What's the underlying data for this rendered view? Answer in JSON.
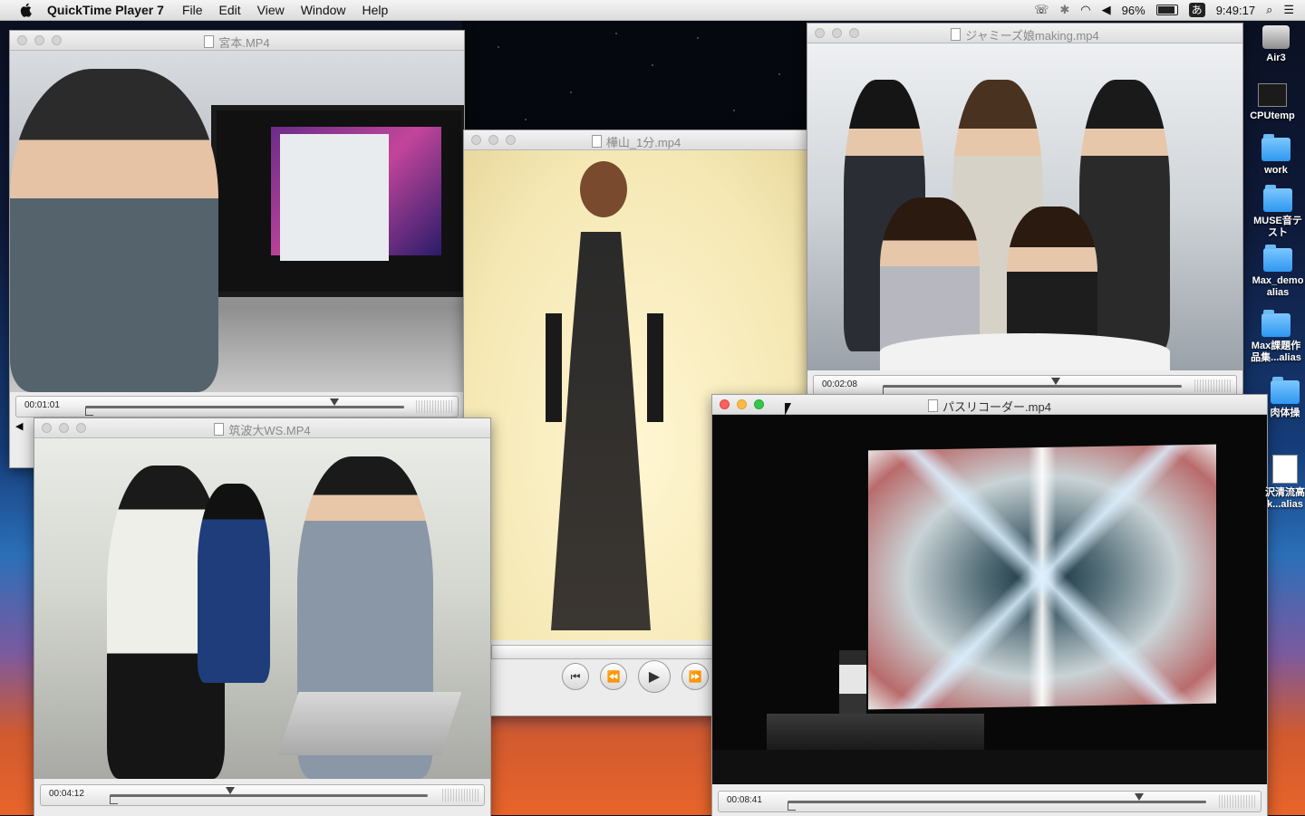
{
  "menubar": {
    "app_name": "QuickTime Player 7",
    "menus": [
      "File",
      "Edit",
      "View",
      "Window",
      "Help"
    ],
    "battery": "96%",
    "ime": "あ",
    "clock": "9:49:17"
  },
  "windows": [
    {
      "title": "宮本.MP4",
      "timecode": "00:01:01"
    },
    {
      "title": "筑波大WS.MP4",
      "timecode": "00:04:12"
    },
    {
      "title": "樺山_1分.mp4"
    },
    {
      "title": "ジャミーズ娘making.mp4",
      "timecode": "00:02:08"
    },
    {
      "title": "パスリコーダー.mp4",
      "timecode": "00:08:41"
    }
  ],
  "playback_progress": {
    "miyamoto": 0.78,
    "tsukuba": 0.38,
    "jammies": 0.58,
    "pasu": 0.84
  },
  "desktop_icons": [
    {
      "label": "Air3",
      "kind": "drive"
    },
    {
      "label": "CPUtemp",
      "kind": "terminal"
    },
    {
      "label": "work",
      "kind": "folder"
    },
    {
      "label": "MUSE音テスト",
      "kind": "folder"
    },
    {
      "label": "Max_demo alias",
      "kind": "folder"
    },
    {
      "label": "Max課題作品集...alias",
      "kind": "folder"
    },
    {
      "label": "肉体操",
      "kind": "folder"
    },
    {
      "label": "沢清流高k...alias",
      "kind": "document"
    }
  ],
  "colors": {
    "close": "#fc605c",
    "minimize": "#fdbc40",
    "zoom": "#34c84a"
  }
}
